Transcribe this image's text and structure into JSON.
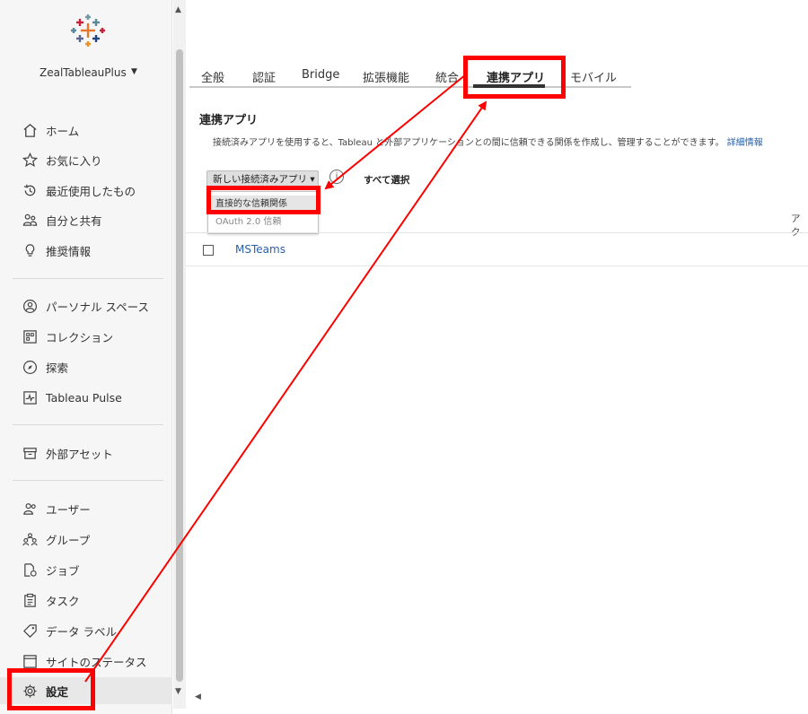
{
  "sidebar": {
    "site_name": "ZealTableauPlus",
    "groups": [
      [
        {
          "name": "home",
          "label": "ホーム",
          "icon": "home-icon"
        },
        {
          "name": "favorites",
          "label": "お気に入り",
          "icon": "star-icon"
        },
        {
          "name": "recents",
          "label": "最近使用したもの",
          "icon": "history-icon"
        },
        {
          "name": "shared",
          "label": "自分と共有",
          "icon": "shared-users-icon"
        },
        {
          "name": "recommendations",
          "label": "推奨情報",
          "icon": "lightbulb-icon"
        }
      ],
      [
        {
          "name": "personal-space",
          "label": "パーソナル スペース",
          "icon": "person-circle-icon"
        },
        {
          "name": "collections",
          "label": "コレクション",
          "icon": "collection-icon"
        },
        {
          "name": "explore",
          "label": "探索",
          "icon": "compass-icon"
        },
        {
          "name": "tableau-pulse",
          "label": "Tableau Pulse",
          "icon": "pulse-icon"
        }
      ],
      [
        {
          "name": "external-assets",
          "label": "外部アセット",
          "icon": "archive-icon"
        }
      ],
      [
        {
          "name": "users",
          "label": "ユーザー",
          "icon": "users-icon"
        },
        {
          "name": "groups",
          "label": "グループ",
          "icon": "group-icon"
        },
        {
          "name": "jobs",
          "label": "ジョブ",
          "icon": "job-icon"
        },
        {
          "name": "tasks",
          "label": "タスク",
          "icon": "clipboard-icon"
        },
        {
          "name": "data-labels",
          "label": "データ ラベル",
          "icon": "tag-icon"
        },
        {
          "name": "site-status",
          "label": "サイトのステータス",
          "icon": "status-window-icon"
        },
        {
          "name": "settings",
          "label": "設定",
          "icon": "gear-icon",
          "active": true
        }
      ]
    ]
  },
  "tabs": [
    "全般",
    "認証",
    "Bridge",
    "拡張機能",
    "統合",
    "連携アプリ",
    "モバイル"
  ],
  "active_tab": "連携アプリ",
  "section": {
    "title": "連携アプリ",
    "description": "接続済みアプリを使用すると、Tableau と外部アプリケーションとの間に信頼できる関係を作成し、管理することができます。",
    "link": "詳細情報"
  },
  "toolbar": {
    "new_button": "新しい接続済みアプリ ▾",
    "select_all": "すべて選択"
  },
  "dropdown": {
    "items": [
      "直接的な信頼関係",
      "OAuth 2.0 信頼"
    ]
  },
  "table": {
    "column_header": "アク",
    "rows": [
      {
        "name": "MSTeams"
      }
    ]
  },
  "colors": {
    "annotation": "#ff0000",
    "link": "#2a5fa8",
    "sidebar_bg": "#f6f6f6"
  }
}
